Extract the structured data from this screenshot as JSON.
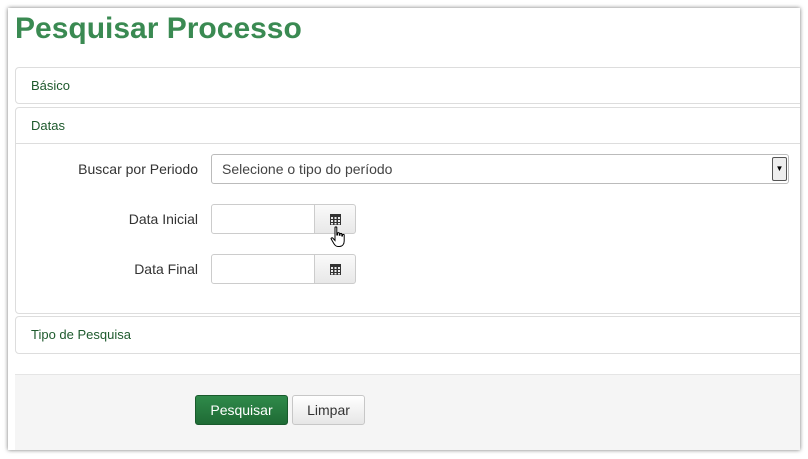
{
  "page": {
    "title": "Pesquisar Processo"
  },
  "panels": {
    "basico": "Básico",
    "datas": "Datas",
    "tipo_pesquisa": "Tipo de Pesquisa"
  },
  "form": {
    "periodo_label": "Buscar por Periodo",
    "periodo_value": "Selecione o tipo do período",
    "data_inicial_label": "Data Inicial",
    "data_inicial_value": "",
    "data_final_label": "Data Final",
    "data_final_value": ""
  },
  "actions": {
    "search_label": "Pesquisar",
    "clear_label": "Limpar"
  },
  "icons": {
    "calendar": "calendar-icon",
    "select_arrow": "chevron-down-icon",
    "cursor": "hand-pointer-icon"
  },
  "colors": {
    "title": "#3a8a52",
    "panel_heading": "#1e5a2d",
    "primary_button": "#1f6b35"
  }
}
